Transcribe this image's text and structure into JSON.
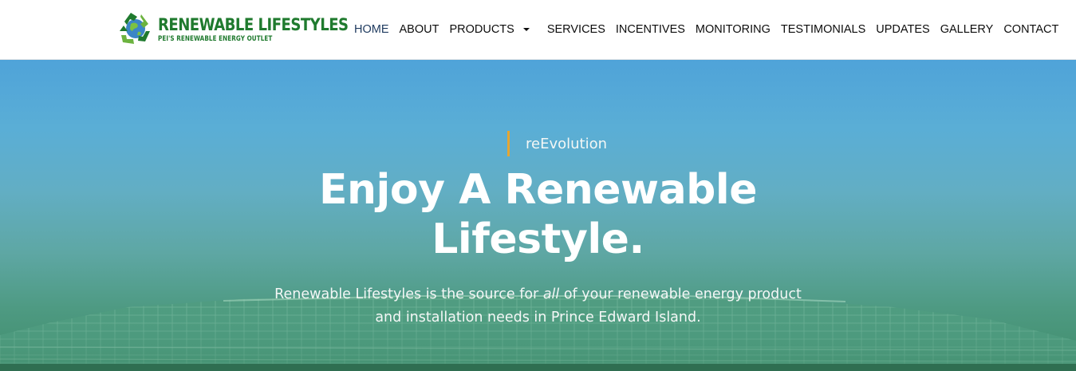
{
  "logo": {
    "title": "RENEWABLE LIFESTYLES",
    "subtitle": "PEI'S RENEWABLE ENERGY OUTLET",
    "icon": "recycle-globe-icon",
    "colors": {
      "green": "#1f7a2e",
      "light_green": "#6cb33f",
      "blue": "#3b86c6"
    }
  },
  "nav": {
    "items": [
      {
        "label": "HOME",
        "active": true
      },
      {
        "label": "ABOUT"
      },
      {
        "label": "PRODUCTS",
        "has_dropdown": true,
        "dropdown_icon": "caret-down-icon"
      },
      {
        "label": "SERVICES"
      },
      {
        "label": "INCENTIVES"
      },
      {
        "label": "MONITORING"
      },
      {
        "label": "TESTIMONIALS"
      },
      {
        "label": "UPDATES"
      },
      {
        "label": "GALLERY"
      },
      {
        "label": "CONTACT"
      }
    ]
  },
  "hero": {
    "tagline": "reEvolution",
    "headline_line1": "Enjoy A Renewable",
    "headline_line2": "Lifestyle.",
    "subtext_before": "Renewable Lifestyles is the source for ",
    "subtext_emphasis": "all",
    "subtext_after": " of your renewable energy product and installation needs in Prince Edward Island.",
    "background": "solar-panel-roof-photo",
    "accent_color": "#e5a632"
  }
}
